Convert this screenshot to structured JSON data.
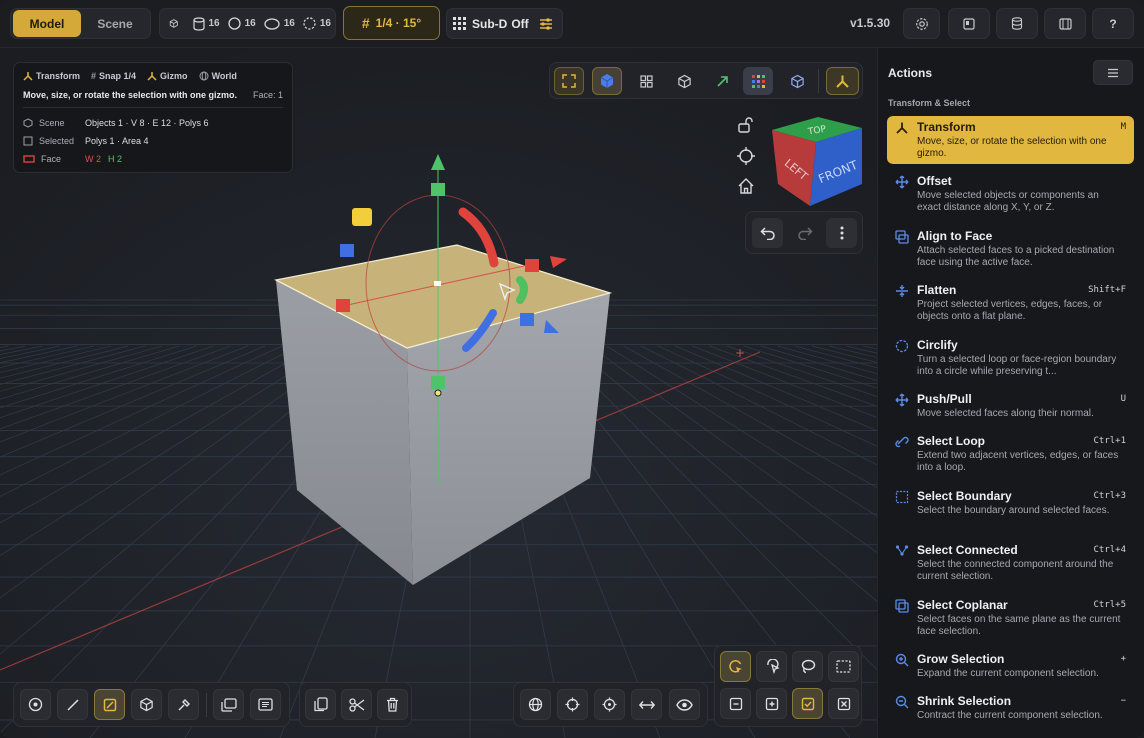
{
  "topbar": {
    "modes": [
      {
        "label": "Model",
        "active": true
      },
      {
        "label": "Scene",
        "active": false
      }
    ],
    "counts": [
      {
        "icon": "cube-icon",
        "value": "16"
      },
      {
        "icon": "cylinder-icon",
        "value": "16"
      },
      {
        "icon": "circle-icon",
        "value": "16"
      },
      {
        "icon": "ellipse-icon",
        "value": "16"
      },
      {
        "icon": "dashed-circle-icon",
        "value": "16"
      }
    ],
    "snap_label": "1/4 · 15°",
    "subd_label": "Sub-D",
    "subd_state": "Off",
    "version": "v1.5.30"
  },
  "info": {
    "tags": [
      "Transform",
      "Snap 1/4",
      "Gizmo",
      "World"
    ],
    "description": "Move, size, or rotate the selection with one gizmo.",
    "face_label": "Face: 1",
    "rows": [
      {
        "key": "Scene",
        "value": "Objects 1 · V 8 · E 12 · Polys 6"
      },
      {
        "key": "Selected",
        "value": "Polys 1 · Area 4"
      },
      {
        "key": "Face",
        "w": "W 2",
        "h": "H 2"
      }
    ]
  },
  "navcube": {
    "top": "TOP",
    "left": "LEFT",
    "front": "FRONT"
  },
  "sidebar": {
    "title": "Actions",
    "section": "Transform & Select",
    "actions": [
      {
        "name": "Transform",
        "desc": "Move, size, or rotate the selection with one gizmo.",
        "shortcut": "M",
        "active": true,
        "icon": "transform-icon"
      },
      {
        "name": "Offset",
        "desc": "Move selected objects or components an exact distance along X, Y, or Z.",
        "shortcut": "",
        "icon": "move-icon"
      },
      {
        "name": "Align to Face",
        "desc": "Attach selected faces to a picked destination face using the active face.",
        "shortcut": "",
        "icon": "align-face-icon"
      },
      {
        "name": "Flatten",
        "desc": "Project selected vertices, edges, faces, or objects onto a flat plane.",
        "shortcut": "Shift+F",
        "icon": "flatten-icon"
      },
      {
        "name": "Circlify",
        "desc": "Turn a selected loop or face-region boundary into a circle while preserving t...",
        "shortcut": "",
        "icon": "circlify-icon"
      },
      {
        "name": "Push/Pull",
        "desc": "Move selected faces along their normal.",
        "shortcut": "U",
        "icon": "push-pull-icon"
      },
      {
        "name": "Select Loop",
        "desc": "Extend two adjacent vertices, edges, or faces into a loop.",
        "shortcut": "Ctrl+1",
        "icon": "loop-icon"
      },
      {
        "name": "Select Boundary",
        "desc": "Select the boundary around selected faces.",
        "shortcut": "Ctrl+3",
        "icon": "boundary-icon"
      },
      {
        "name": "Select Connected",
        "desc": "Select the connected component around the current selection.",
        "shortcut": "Ctrl+4",
        "icon": "connected-icon"
      },
      {
        "name": "Select Coplanar",
        "desc": "Select faces on the same plane as the current face selection.",
        "shortcut": "Ctrl+5",
        "icon": "coplanar-icon"
      },
      {
        "name": "Grow Selection",
        "desc": "Expand the current component selection.",
        "shortcut": "+",
        "icon": "grow-icon"
      },
      {
        "name": "Shrink Selection",
        "desc": "Contract the current component selection.",
        "shortcut": "−",
        "icon": "shrink-icon"
      }
    ]
  }
}
